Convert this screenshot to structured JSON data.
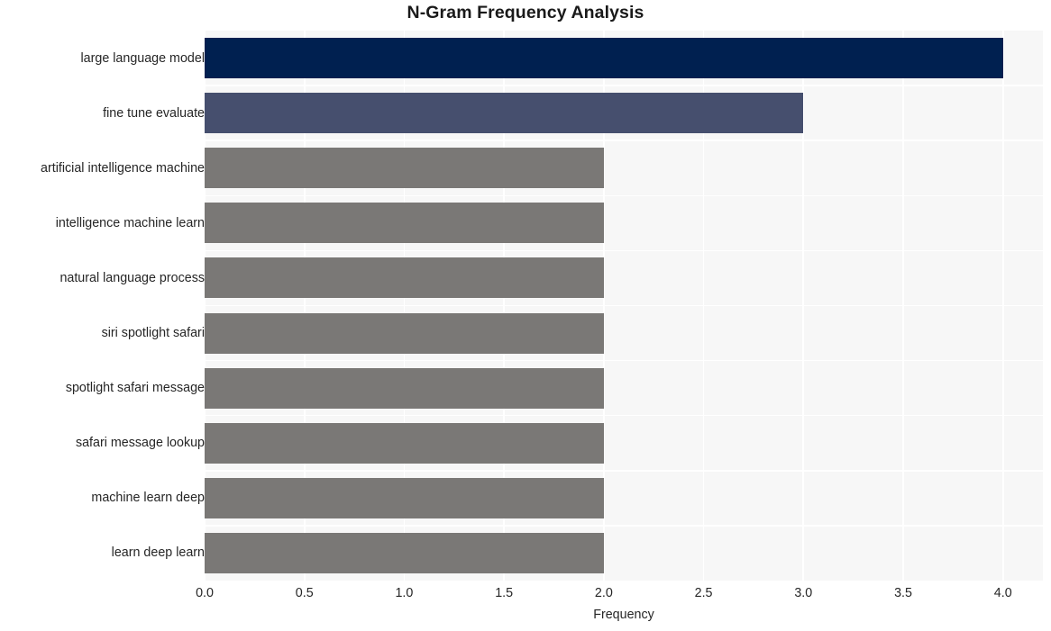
{
  "chart_data": {
    "type": "bar",
    "orientation": "horizontal",
    "title": "N-Gram Frequency Analysis",
    "xlabel": "Frequency",
    "ylabel": "",
    "xlim": [
      0.0,
      4.2
    ],
    "grid": true,
    "legend": null,
    "categories": [
      "large language model",
      "fine tune evaluate",
      "artificial intelligence machine",
      "intelligence machine learn",
      "natural language process",
      "siri spotlight safari",
      "spotlight safari message",
      "safari message lookup",
      "machine learn deep",
      "learn deep learn"
    ],
    "values": [
      4,
      3,
      2,
      2,
      2,
      2,
      2,
      2,
      2,
      2
    ],
    "bar_colors": [
      "#002050",
      "#464f6e",
      "#7a7876",
      "#7a7876",
      "#7a7876",
      "#7a7876",
      "#7a7876",
      "#7a7876",
      "#7a7876",
      "#7a7876"
    ],
    "xticks": [
      "0.0",
      "0.5",
      "1.0",
      "1.5",
      "2.0",
      "2.5",
      "3.0",
      "3.5",
      "4.0"
    ],
    "xtick_values": [
      0.0,
      0.5,
      1.0,
      1.5,
      2.0,
      2.5,
      3.0,
      3.5,
      4.0
    ],
    "plot_background": "#f7f7f7",
    "gridline_color": "#ffffff",
    "figure_background": "#ffffff",
    "text_color": "#262626",
    "title_color": "#1a1a1a"
  }
}
